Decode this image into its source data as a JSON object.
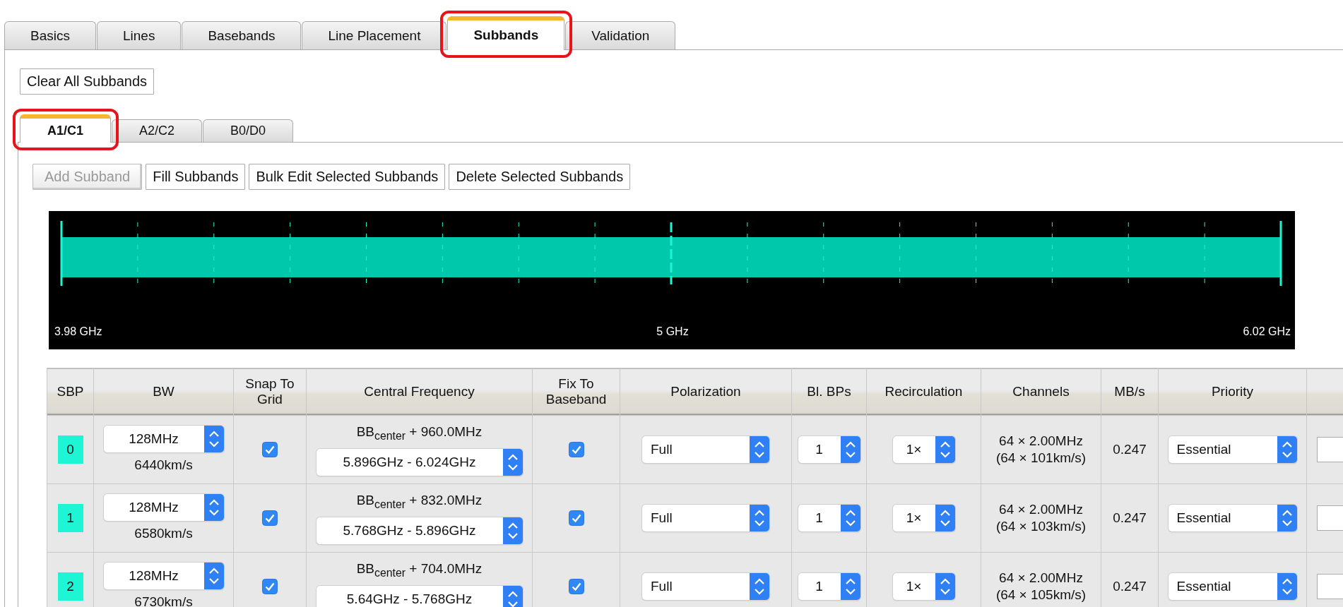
{
  "main_tabs": [
    {
      "label": "Basics",
      "selected": false,
      "highlighted": false
    },
    {
      "label": "Lines",
      "selected": false,
      "highlighted": false
    },
    {
      "label": "Basebands",
      "selected": false,
      "highlighted": false
    },
    {
      "label": "Line Placement",
      "selected": false,
      "highlighted": false
    },
    {
      "label": "Subbands",
      "selected": true,
      "highlighted": true
    },
    {
      "label": "Validation",
      "selected": false,
      "highlighted": false
    }
  ],
  "clear_button": "Clear All Subbands",
  "sub_tabs": [
    {
      "label": "A1/C1",
      "selected": true,
      "highlighted": true
    },
    {
      "label": "A2/C2",
      "selected": false,
      "highlighted": false
    },
    {
      "label": "B0/D0",
      "selected": false,
      "highlighted": false
    }
  ],
  "actions": [
    {
      "label": "Add Subband",
      "disabled": true
    },
    {
      "label": "Fill Subbands",
      "disabled": false
    },
    {
      "label": "Bulk Edit Selected Subbands",
      "disabled": false
    },
    {
      "label": "Delete Selected Subbands",
      "disabled": false
    }
  ],
  "spectrum": {
    "labels": [
      "3.98 GHz",
      "5 GHz",
      "6.02 GHz"
    ]
  },
  "table": {
    "columns": [
      "SBP",
      "BW",
      "Snap To Grid",
      "Central Frequency",
      "Fix To Baseband",
      "Polarization",
      "Bl. BPs",
      "Recirculation",
      "Channels",
      "MB/s",
      "Priority"
    ],
    "rows": [
      {
        "sbp": "0",
        "bw": "128MHz",
        "velocity": "6440km/s",
        "snap_to_grid": true,
        "offset": "BB$_{center}$ + 960.0MHz",
        "range": "5.896GHz - 6.024GHz",
        "fix_to_baseband": true,
        "polarization": "Full",
        "bl_bps": "1",
        "recirculation": "1×",
        "channels": "64 × 2.00MHz",
        "channel_velocity": "(64 × 101km/s)",
        "rate": "0.247",
        "priority": "Essential"
      },
      {
        "sbp": "1",
        "bw": "128MHz",
        "velocity": "6580km/s",
        "snap_to_grid": true,
        "offset": "BB$_{center}$ + 832.0MHz",
        "range": "5.768GHz - 5.896GHz",
        "fix_to_baseband": true,
        "polarization": "Full",
        "bl_bps": "1",
        "recirculation": "1×",
        "channels": "64 × 2.00MHz",
        "channel_velocity": "(64 × 103km/s)",
        "rate": "0.247",
        "priority": "Essential"
      },
      {
        "sbp": "2",
        "bw": "128MHz",
        "velocity": "6730km/s",
        "snap_to_grid": true,
        "offset": "BB$_{center}$ + 704.0MHz",
        "range": "5.64GHz - 5.768GHz",
        "fix_to_baseband": true,
        "polarization": "Full",
        "bl_bps": "1",
        "recirculation": "1×",
        "channels": "64 × 2.00MHz",
        "channel_velocity": "(64 × 105km/s)",
        "rate": "0.247",
        "priority": "Essential"
      }
    ]
  }
}
